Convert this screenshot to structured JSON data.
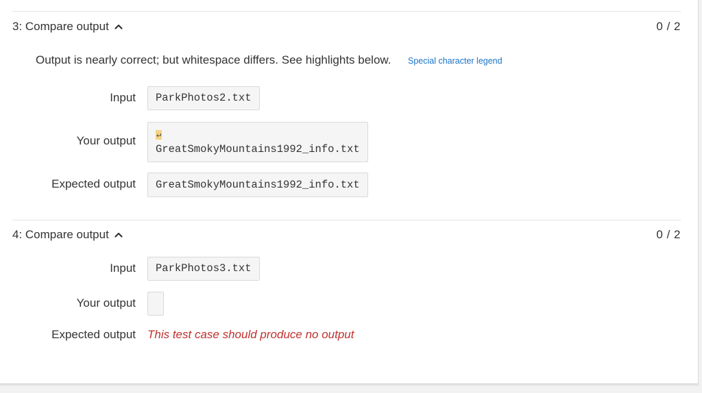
{
  "sections": [
    {
      "title": "3: Compare output",
      "score": "0 / 2",
      "message": "Output is nearly correct; but whitespace differs. See highlights below.",
      "legend_link": "Special character legend",
      "input_label": "Input",
      "input_value": "ParkPhotos2.txt",
      "your_output_label": "Your output",
      "your_output_newline": "↵",
      "your_output_value": "GreatSmokyMountains1992_info.txt",
      "expected_label": "Expected output",
      "expected_value": "GreatSmokyMountains1992_info.txt"
    },
    {
      "title": "4: Compare output",
      "score": "0 / 2",
      "input_label": "Input",
      "input_value": "ParkPhotos3.txt",
      "your_output_label": "Your output",
      "your_output_value": "",
      "expected_label": "Expected output",
      "expected_value": "This test case should produce no output"
    }
  ],
  "colors": {
    "link": "#1a73c8",
    "error_text": "#c0302e",
    "whitespace_highlight": "#f3d487"
  },
  "icons": {
    "collapse": "chevron-up-icon"
  }
}
